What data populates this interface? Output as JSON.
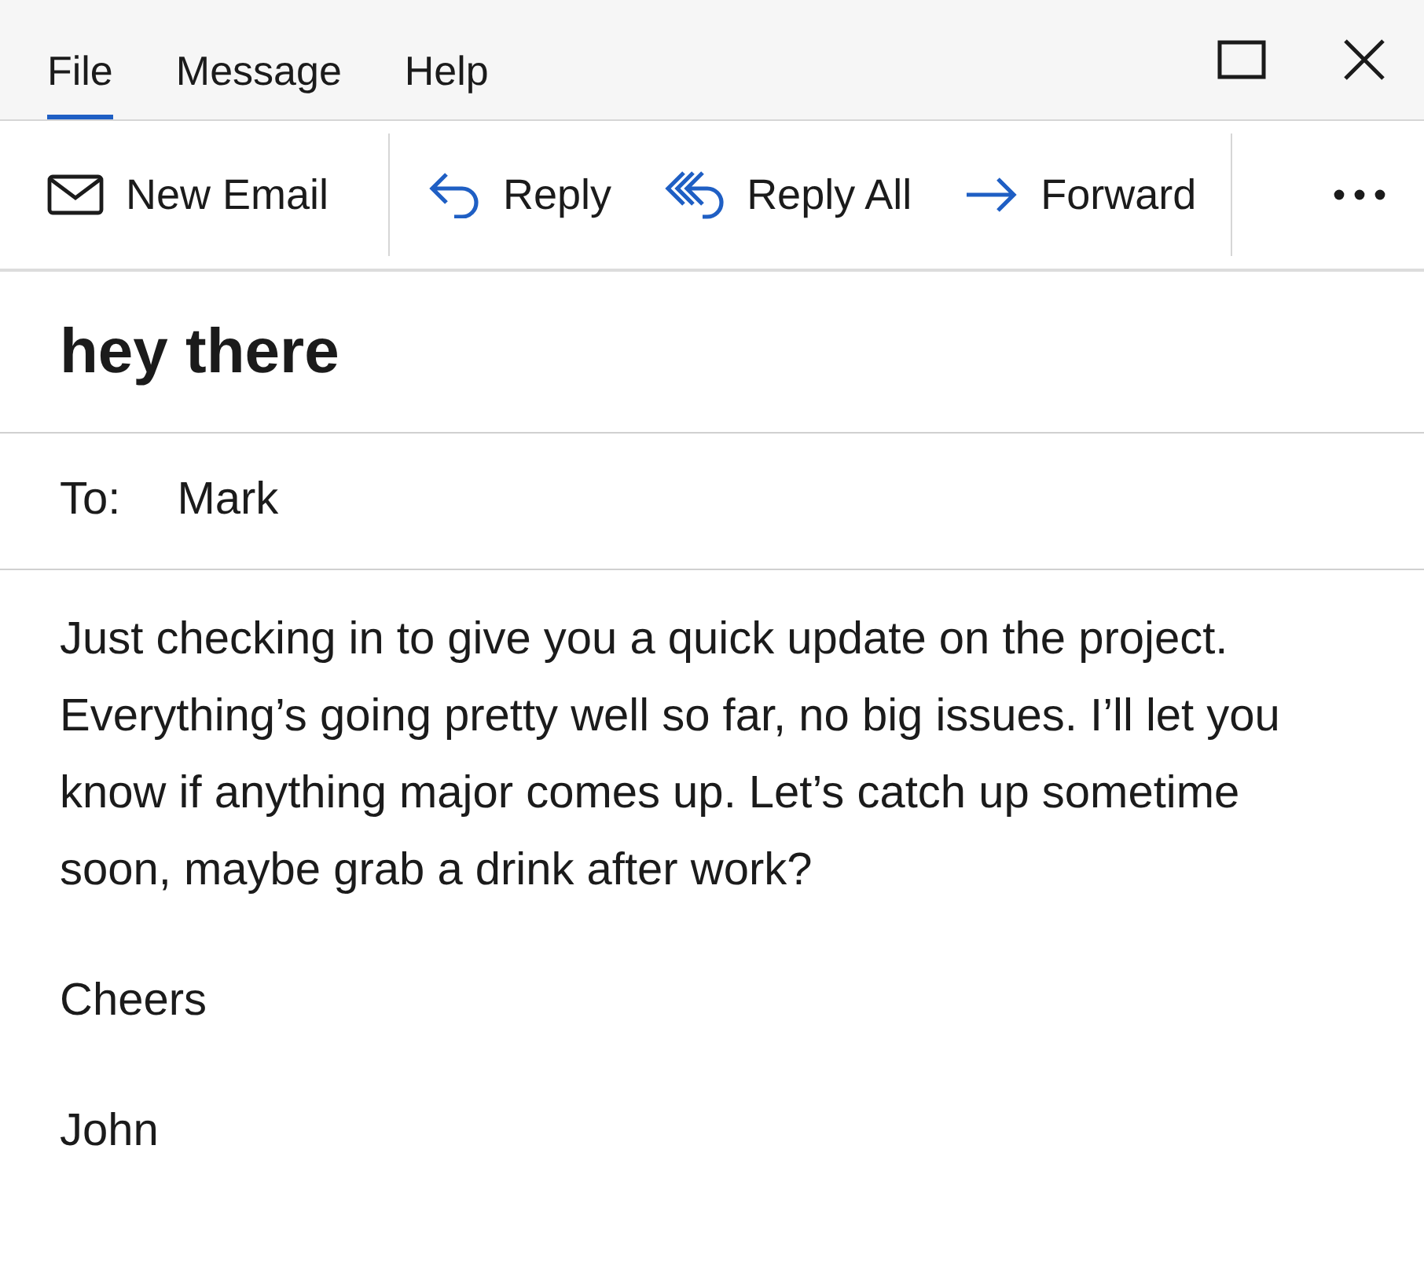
{
  "menu": [
    {
      "label": "File",
      "selected": true
    },
    {
      "label": "Message",
      "selected": false
    },
    {
      "label": "Help",
      "selected": false
    }
  ],
  "toolbar": [
    {
      "kind": "new",
      "label": "New Email"
    },
    {
      "kind": "reply",
      "label": "Reply"
    },
    {
      "kind": "reply_all",
      "label": "Reply All"
    },
    {
      "kind": "forward",
      "label": "Forward"
    }
  ],
  "subject": "hey there",
  "to": {
    "label": "To:",
    "value": "Mark"
  },
  "body": [
    "Just checking in to give you a quick update on the project. Everything’s going pretty well so far, no big issues. I’ll let you know if anything major comes up. Let’s catch up sometime soon, maybe grab a drink after work?",
    "Cheers",
    "John"
  ]
}
